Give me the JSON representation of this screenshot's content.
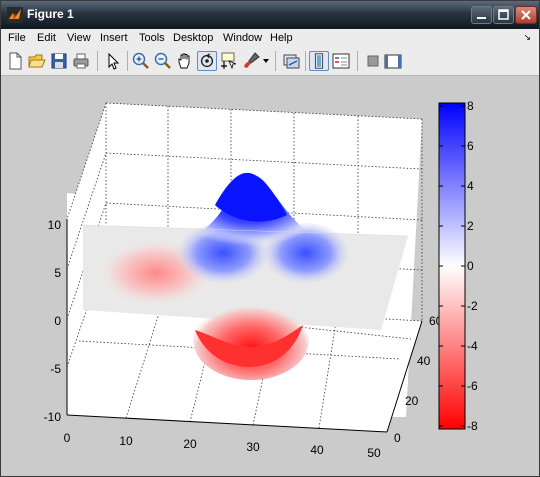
{
  "window": {
    "title": "Figure 1"
  },
  "menu": [
    "File",
    "Edit",
    "View",
    "Insert",
    "Tools",
    "Desktop",
    "Window",
    "Help"
  ],
  "toolbar": {
    "buttons": [
      "new-figure",
      "open-file",
      "save-figure",
      "print-figure",
      "edit-plot",
      "zoom-in",
      "zoom-out",
      "pan",
      "rotate-3d",
      "data-cursor",
      "brush",
      "link-plot",
      "insert-colorbar",
      "insert-legend",
      "hide-plot-tools",
      "show-plot-tools"
    ]
  },
  "chart_data": {
    "type": "surface",
    "x_ticks": [
      "0",
      "10",
      "20",
      "30",
      "40",
      "50"
    ],
    "y_ticks": [
      "0",
      "20",
      "40",
      "60"
    ],
    "z_ticks": [
      "10",
      "5",
      "0",
      "-5",
      "-10"
    ],
    "zlim": [
      -10,
      10
    ],
    "colorbar": {
      "ticks": [
        "8",
        "6",
        "4",
        "2",
        "0",
        "-2",
        "-4",
        "-6",
        "-8"
      ],
      "range": [
        -8,
        8
      ],
      "low_color": "#ff0000",
      "mid_color": "#ffffff",
      "high_color": "#0000ff"
    }
  },
  "colors": {
    "surface_high": "#0000ff",
    "surface_low": "#ff0000",
    "surface_mid": "#eeeeee",
    "figure_bg": "#cbcbcb"
  }
}
